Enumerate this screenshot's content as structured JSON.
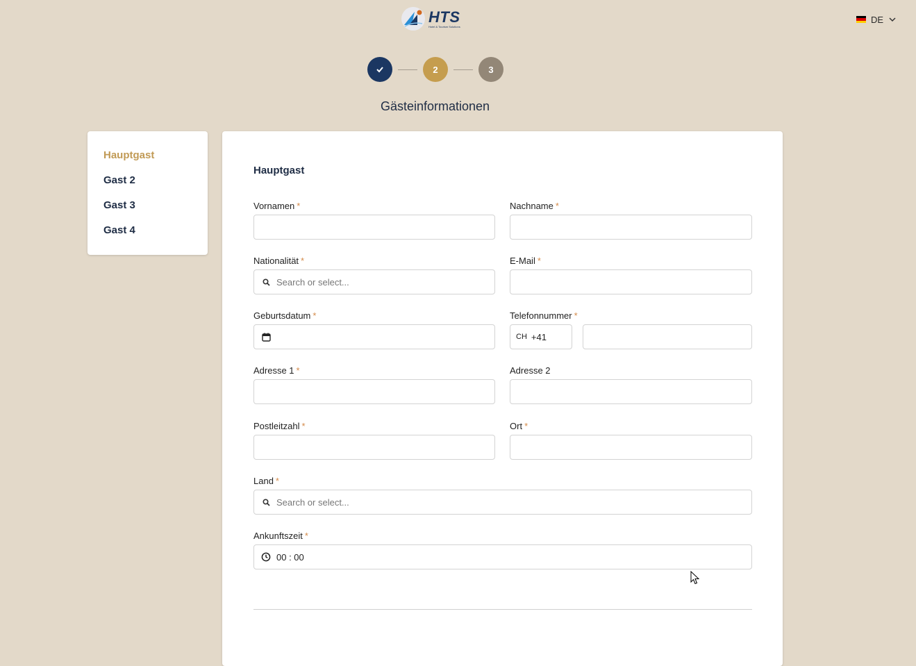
{
  "header": {
    "logo_text": "HTS",
    "logo_sub": "Hotel & Tourism Solutions",
    "language": "DE",
    "flag_colors": [
      "#000000",
      "#dd0000",
      "#ffce00"
    ]
  },
  "stepper": {
    "steps": [
      {
        "label": "",
        "state": "done",
        "color": "#1b3762"
      },
      {
        "label": "2",
        "state": "current",
        "color": "#c59d4e"
      },
      {
        "label": "3",
        "state": "upcoming",
        "color": "#938777"
      }
    ]
  },
  "page_title": "Gästeinformationen",
  "sidebar": {
    "items": [
      {
        "label": "Hauptgast",
        "active": true
      },
      {
        "label": "Gast 2",
        "active": false
      },
      {
        "label": "Gast 3",
        "active": false
      },
      {
        "label": "Gast 4",
        "active": false
      }
    ]
  },
  "form": {
    "title": "Hauptgast",
    "required_mark": "*",
    "fields": {
      "vornamen": {
        "label": "Vornamen",
        "value": ""
      },
      "nachname": {
        "label": "Nachname",
        "value": ""
      },
      "nationalitaet": {
        "label": "Nationalität",
        "placeholder": "Search or select..."
      },
      "email": {
        "label": "E-Mail",
        "value": ""
      },
      "geburtsdatum": {
        "label": "Geburtsdatum",
        "value": ""
      },
      "telefon": {
        "label": "Telefonnummer",
        "country_code": "CH",
        "dial_code": "+41",
        "value": ""
      },
      "adresse1": {
        "label": "Adresse 1",
        "value": ""
      },
      "adresse2": {
        "label": "Adresse 2",
        "value": ""
      },
      "plz": {
        "label": "Postleitzahl",
        "value": ""
      },
      "ort": {
        "label": "Ort",
        "value": ""
      },
      "land": {
        "label": "Land",
        "placeholder": "Search or select..."
      },
      "ankunftszeit": {
        "label": "Ankunftszeit",
        "value": "00 : 00"
      }
    }
  },
  "colors": {
    "background": "#e3d9c9",
    "accent_gold": "#c19a55",
    "navy": "#1b3762",
    "required": "#d48a4a"
  }
}
